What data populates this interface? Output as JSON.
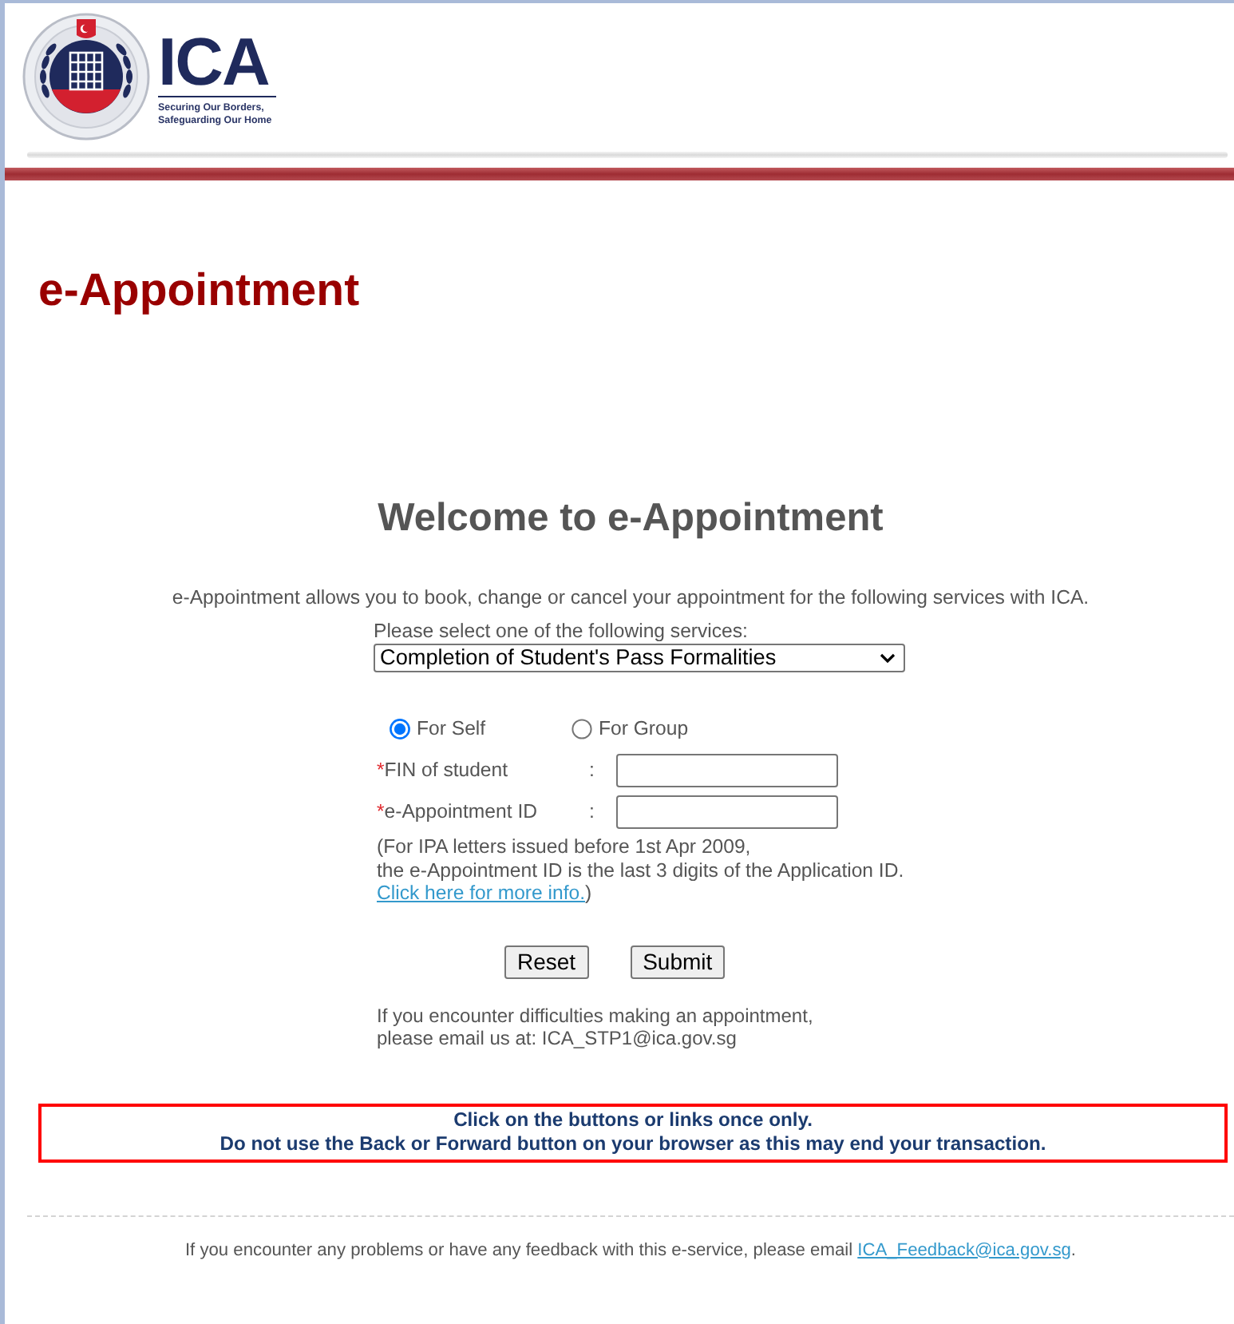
{
  "header": {
    "logo_text": "ICA",
    "tagline": [
      "Securing Our Borders,",
      "Safeguarding Our Home"
    ]
  },
  "page_title": "e-Appointment",
  "welcome": {
    "heading": "Welcome to e-Appointment",
    "intro": "e-Appointment allows you to book, change or cancel your appointment for the following services with ICA."
  },
  "service_select": {
    "label": "Please select one of the following services:",
    "value": "Completion of Student's Pass Formalities"
  },
  "applicant_type": [
    {
      "label": "For Self",
      "selected": true
    },
    {
      "label": "For Group",
      "selected": false
    }
  ],
  "fields": [
    {
      "required_mark": "*",
      "label": "FIN of student",
      "separator": ":"
    },
    {
      "required_mark": "*",
      "label": "e-Appointment ID",
      "separator": ":"
    }
  ],
  "note": {
    "lines": [
      "(For IPA letters issued before 1st Apr 2009,",
      "the e-Appointment ID is the last 3 digits of the Application ID."
    ],
    "link": "Click here for more info.",
    "closing": ")"
  },
  "buttons": [
    "Reset",
    "Submit"
  ],
  "contact": [
    "If you encounter difficulties making an appointment,",
    "please email us at: ICA_STP1@ica.gov.sg"
  ],
  "warning": [
    "Click on the buttons or links once only.",
    "Do not use the Back or Forward button on your browser as this may end your transaction."
  ],
  "footer": {
    "text": "If you encounter any problems or have any feedback with this e-service, please email",
    "link": "ICA_Feedback@ica.gov.sg",
    "end": "."
  }
}
